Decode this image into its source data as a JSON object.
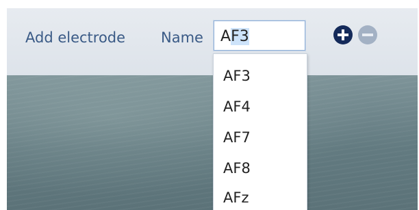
{
  "toolbar": {
    "add_electrode_label": "Add electrode",
    "name_label": "Name",
    "name_value_plain": "A",
    "name_value_selected": "F3"
  },
  "dropdown": {
    "options": [
      "AF3",
      "AF4",
      "AF7",
      "AF8",
      "AFz"
    ]
  },
  "icons": {
    "add": "plus-circle-icon",
    "remove": "minus-circle-icon"
  },
  "colors": {
    "label_text": "#3a5a86",
    "add_button": "#142a5a",
    "remove_button_disabled": "#a3b1c4",
    "selection_highlight": "#cde3fa"
  }
}
